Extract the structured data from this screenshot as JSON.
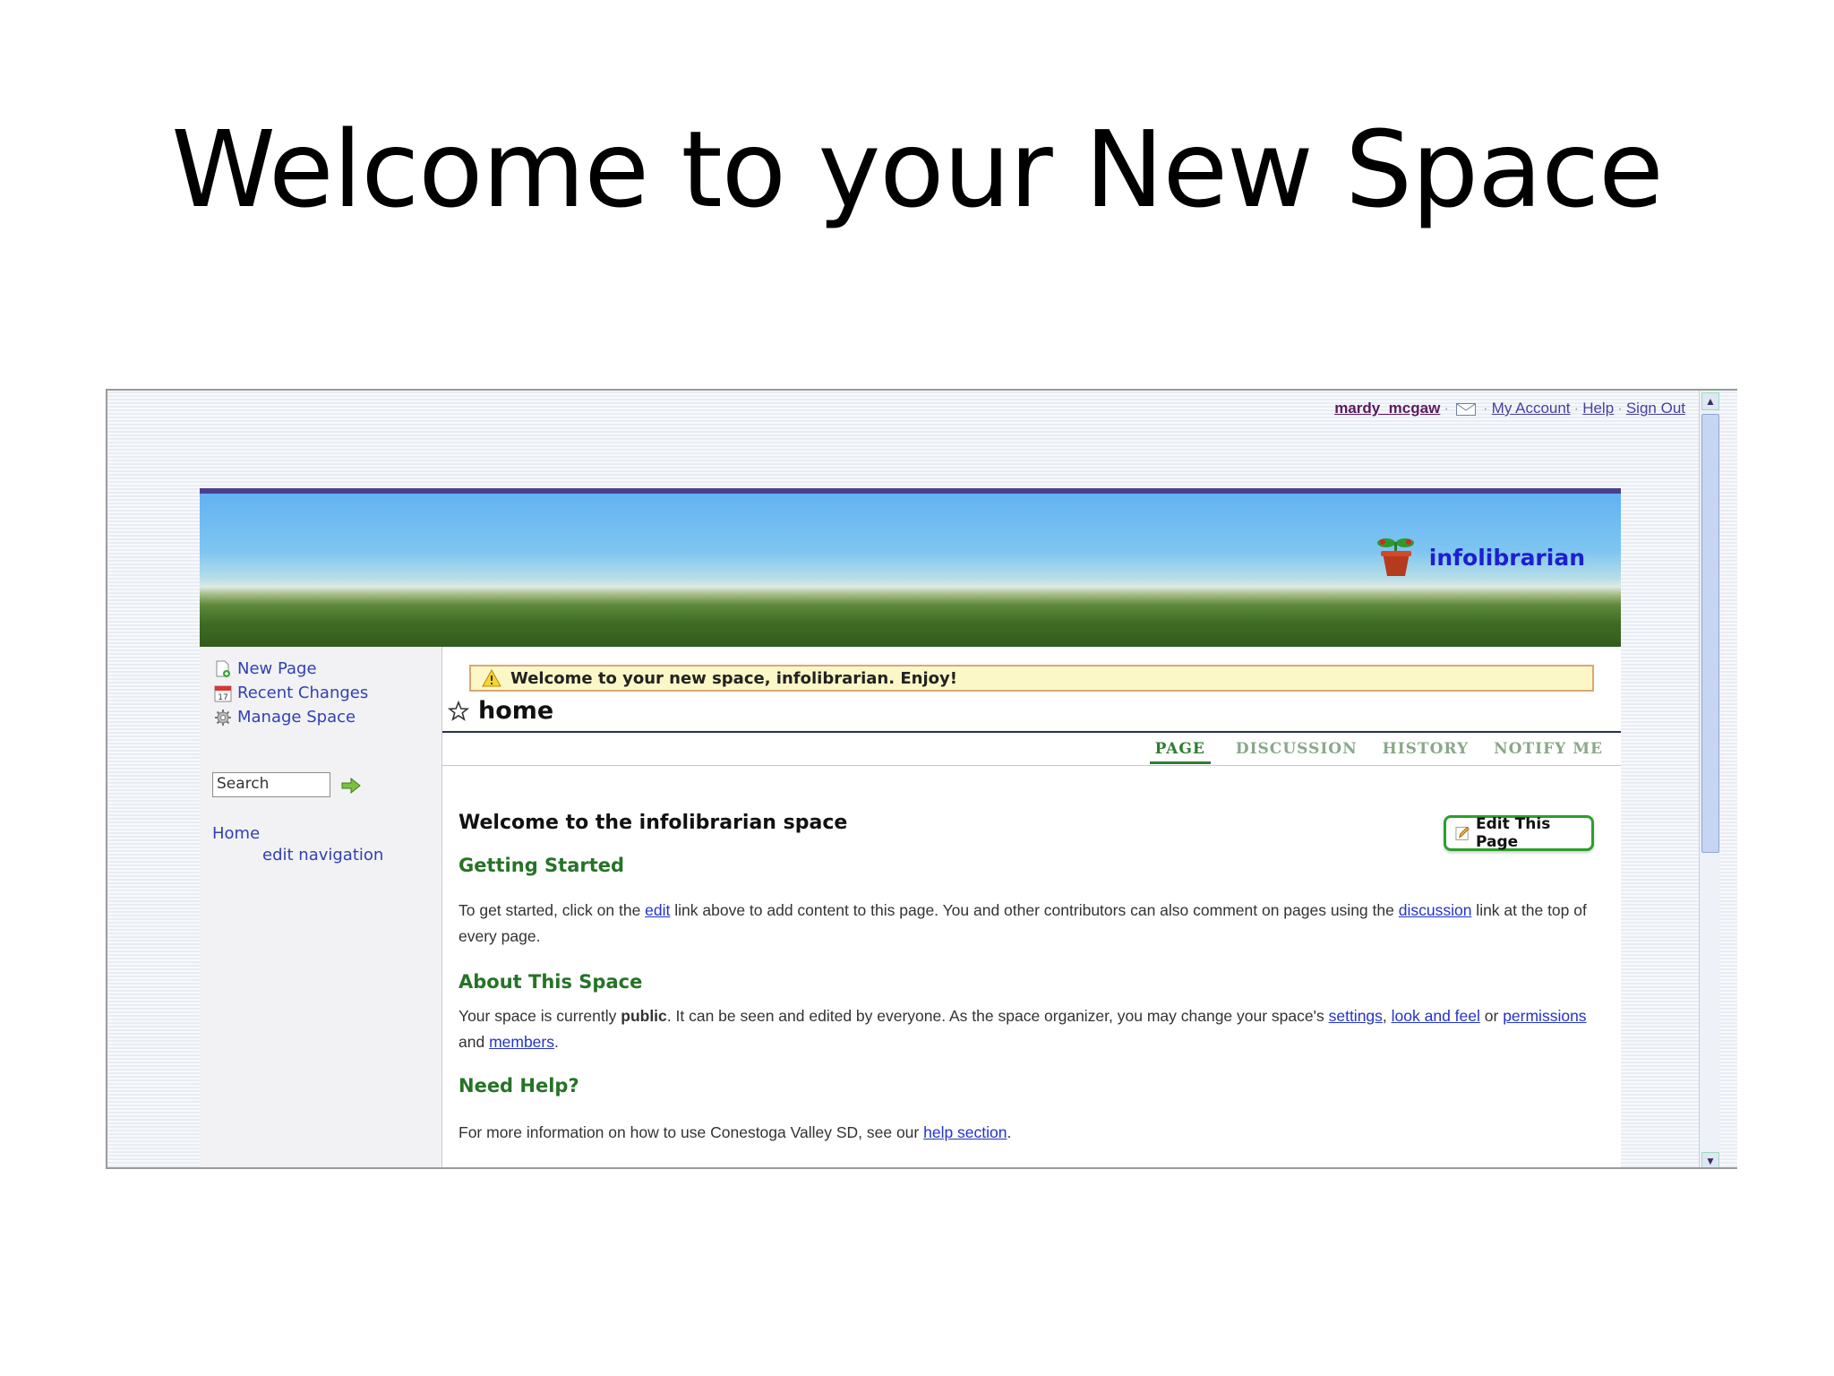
{
  "slide": {
    "title": "Welcome to your New Space"
  },
  "topbar": {
    "user": "mardy_mcgaw",
    "my_account": "My Account",
    "help": "Help",
    "sign_out": "Sign Out"
  },
  "brand": {
    "name": "infolibrarian"
  },
  "sidebar": {
    "actions": [
      {
        "label": "New Page",
        "icon": "new-page-icon"
      },
      {
        "label": "Recent Changes",
        "icon": "calendar-icon"
      },
      {
        "label": "Manage Space",
        "icon": "gear-icon"
      }
    ],
    "search_value": "Search",
    "home_link": "Home",
    "edit_navigation": "edit navigation"
  },
  "alert": {
    "text": "Welcome to your new space, infolibrarian. Enjoy!"
  },
  "page": {
    "name": "home"
  },
  "tabs": [
    "PAGE",
    "DISCUSSION",
    "HISTORY",
    "NOTIFY ME"
  ],
  "edit_button": "Edit This Page",
  "body": {
    "heading": "Welcome to the infolibrarian space",
    "getting_started": {
      "title": "Getting Started",
      "t1": "To get started, click on the ",
      "link1": "edit",
      "t2": " link above to add content to this page. You and other contributors can also comment on pages using the ",
      "link2": "discussion",
      "t3": " link at the top of every page."
    },
    "about": {
      "title": "About This Space",
      "t1": "Your space is currently ",
      "bold": "public",
      "t2": ". It can be seen and edited by everyone. As the space organizer, you may change your space's ",
      "link_settings": "settings",
      "comma": ", ",
      "link_look": "look and feel",
      "t3": " or ",
      "link_permissions": "permissions",
      "t4": " and ",
      "link_members": "members",
      "t5": "."
    },
    "help": {
      "title": "Need Help?",
      "t1": "For more information on how to use Conestoga Valley SD, see our ",
      "link": "help section",
      "t2": "."
    }
  },
  "colors": {
    "link": "#2233cc",
    "green_heading": "#267326",
    "banner_top": "#4a3f8f"
  }
}
